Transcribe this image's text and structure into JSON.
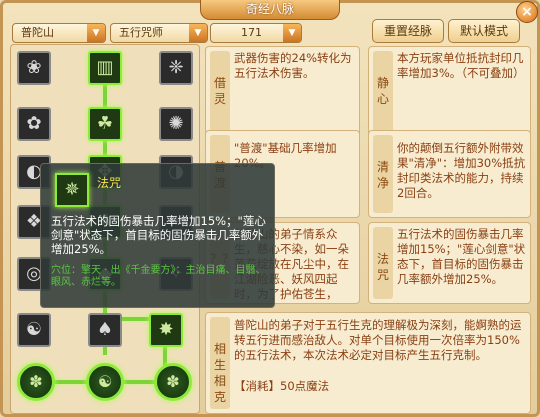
{
  "window": {
    "title": "奇经八脉",
    "close_glyph": "×"
  },
  "controls": {
    "school_select": "普陀山",
    "role_select": "五行咒师",
    "level_select": "171",
    "reset_button": "重置经脉",
    "default_button": "默认模式",
    "arrow_glyph": "▼"
  },
  "skills": {
    "r1c1": "❀",
    "r1c2": "▥",
    "r1c3": "❈",
    "r2c1": "✿",
    "r2c2": "☘",
    "r2c3": "✺",
    "r3c1": "◐",
    "r3c2": "✥",
    "r3c3": "◑",
    "r4c1": "❖",
    "r4c2": "♣",
    "r4c3": "✦",
    "r5c1": "◎",
    "r5c2": "◆",
    "r5c3": "✧",
    "r6c1": "☯",
    "r6c2": "♠",
    "r6c3": "✸",
    "b1": "✽",
    "b2": "☯",
    "b3": "✽"
  },
  "cards": [
    {
      "tag": "借灵",
      "text": "武器伤害的24%转化为五行法术伤害。"
    },
    {
      "tag": "静心",
      "text": "本方玩家单位抵抗封印几率增加3%。（不可叠加）"
    },
    {
      "tag": "普渡",
      "text": "\"普渡\"基础几率增加20%。"
    },
    {
      "tag": "清净",
      "text": "你的颠倒五行额外附带效果\"清净\"：增加30%抵抗封印类法术的能力，持续2回合。"
    },
    {
      "tag": "？？",
      "text": "普陀山的弟子情系众生，慈心不染，如一朵莲花绽放在凡尘中，在江湖险恶、妖风四起时，为了护佑苍生，"
    },
    {
      "tag": "法咒",
      "text": "五行法术的固伤暴击几率增加15%；\"莲心剑意\"状态下，首目标的固伤暴击几率额外增加25%。"
    },
    {
      "tag": "相生相克",
      "text": "普陀山的弟子对于五行生克的理解极为深刻，能婀熟的运转五行进而感治敌人。对单个目标使用一次倍率为150%的五行法术，本次法术必定对目标产生五行克制。",
      "cost": "【消耗】50点魔法"
    }
  ],
  "tooltip": {
    "name": "法咒",
    "icon": "✵",
    "desc": "五行法术的固伤暴击几率增加15%；\"莲心剑意\"状态下，首目标的固伤暴击几率额外增加25%。",
    "meta": "穴位：擎天 · 出《千金要方》：主治目痛、目翳、眼风、赤烂等。"
  }
}
